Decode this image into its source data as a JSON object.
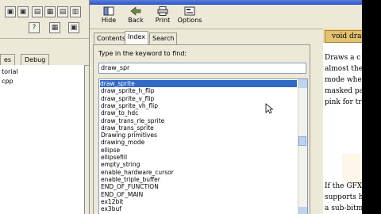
{
  "ide": {
    "toolbar_row1": [
      "▣",
      "▣",
      "▤",
      "▦",
      "▤",
      "▥",
      "▣"
    ],
    "toolbar_row2": [
      "?",
      "▦",
      "▣"
    ],
    "tabs": [
      {
        "label": "es"
      },
      {
        "label": "Debug"
      }
    ],
    "pane_items": [
      "torial",
      "cpp"
    ]
  },
  "help": {
    "toolbar": {
      "hide": "Hide",
      "back": "Back",
      "print": "Print",
      "options": "Options"
    },
    "nav_tabs": [
      {
        "label": "Contents"
      },
      {
        "label": "Index"
      },
      {
        "label": "Search"
      }
    ],
    "keyword_label": "Type in the keyword to find:",
    "keyword_value": "draw_spr",
    "index_items": [
      "draw_sprite",
      "draw_sprite_h_flip",
      "draw_sprite_v_flip",
      "draw_sprite_vh_flip",
      "draw_to_hdc",
      "draw_trans_rle_sprite",
      "draw_trans_sprite",
      "Drawing primitives",
      "drawing_mode",
      "ellipse",
      "ellipsefill",
      "empty_string",
      "enable_hardware_cursor",
      "enable_triple_buffer",
      "END_OF_FUNCTION",
      "END_OF_MAIN",
      "ex12bit",
      "ex3buf"
    ],
    "selected_index": 0,
    "content": {
      "header": "void drav",
      "lines_top": [
        "Draws a c",
        "almost the",
        "mode wher",
        "masked pa",
        "pink for tru"
      ],
      "lines_bottom": [
        "If the GFX",
        "supports ha",
        "a sub-bitm"
      ]
    }
  },
  "colors": {
    "selection": "#316ac5",
    "content_header": "#f0d9a3"
  }
}
